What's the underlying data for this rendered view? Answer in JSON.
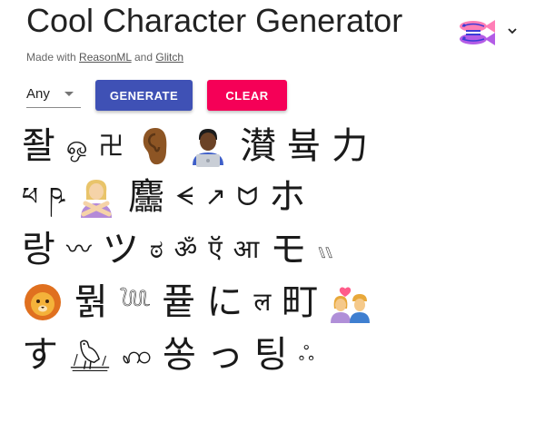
{
  "header": {
    "title": "Cool Character Generator",
    "made_with_prefix": "Made with",
    "link_reasonml": "ReasonML",
    "and_text": "and",
    "link_glitch": "Glitch"
  },
  "controls": {
    "select_value": "Any",
    "generate_label": "GENERATE",
    "clear_label": "CLEAR"
  },
  "colors": {
    "generate": "#3f51b5",
    "clear": "#f50057"
  },
  "rows": [
    [
      "좔",
      "ஒ",
      "卍",
      "",
      "",
      "濽",
      "븈",
      "力"
    ],
    [
      "ཕ",
      "ཥ",
      "",
      "麢",
      "ᗕ",
      "↗",
      "ᗢ",
      "ホ"
    ],
    [
      "랑",
      "〰",
      "ツ",
      "ಠ",
      "ॐ",
      "ऍ",
      "आ",
      "モ",
      "𓏭"
    ],
    [
      "",
      "뭙",
      "𓆙",
      "픁",
      "に",
      "ल",
      "町",
      ""
    ],
    [
      "す",
      "",
      "ꩲ",
      "쏭",
      "っ",
      "팅",
      "ஃ"
    ]
  ],
  "icons": {
    "ear": "ear-emoji",
    "technologist": "technologist-emoji",
    "crossed_arms": "person-gesturing-no-emoji",
    "lion": "lion-face-emoji",
    "couple": "couple-with-heart-emoji",
    "bird": "egyptian-hieroglyph-bird"
  }
}
